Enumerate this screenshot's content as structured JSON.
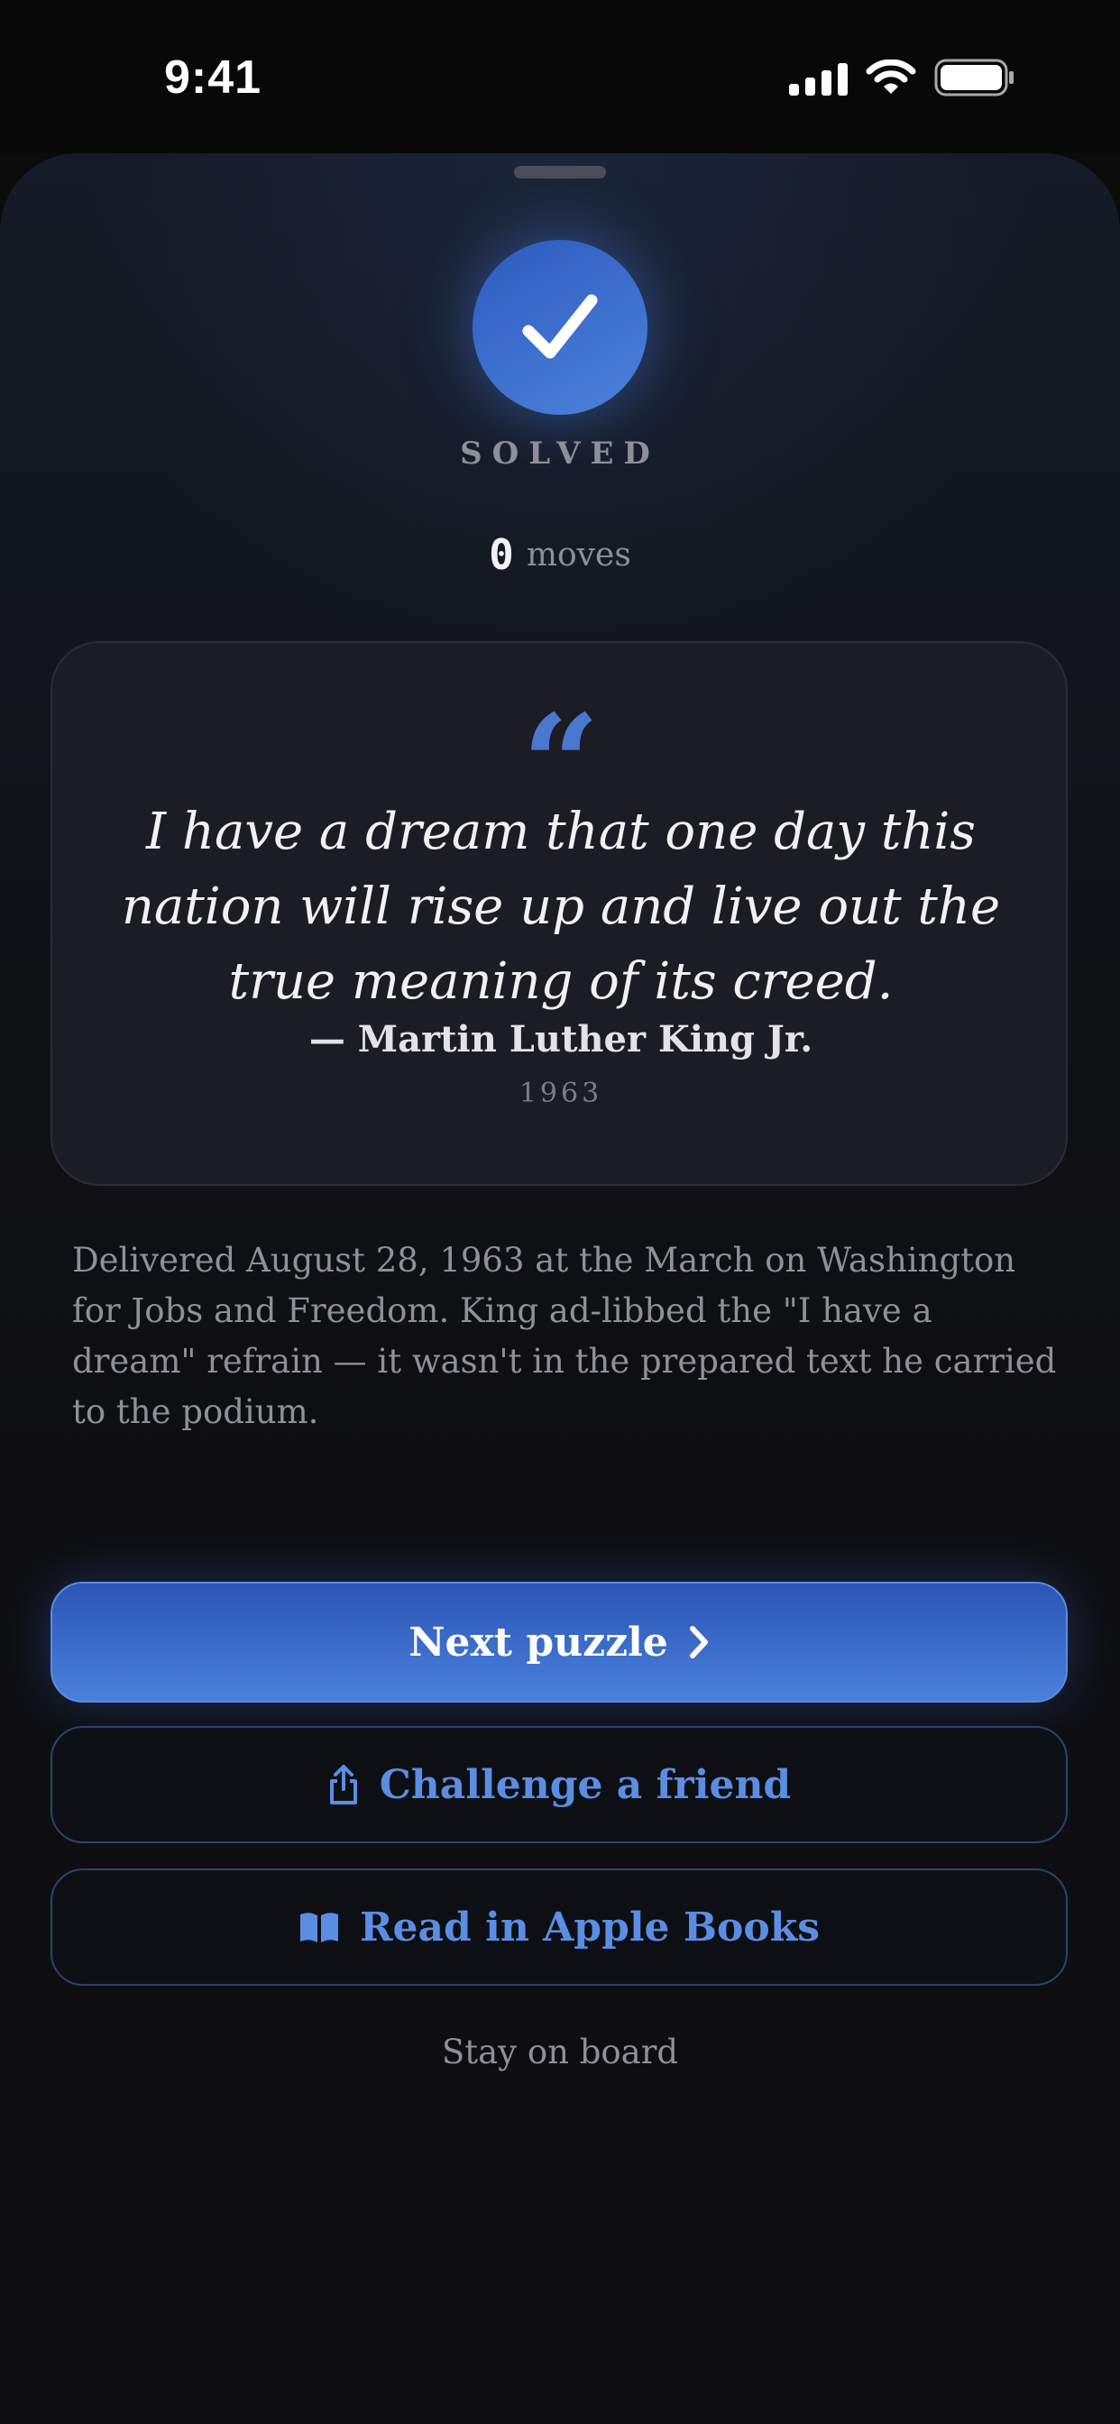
{
  "status_bar": {
    "time": "9:41",
    "icons": [
      "signal-icon",
      "wifi-icon",
      "battery-icon"
    ]
  },
  "result": {
    "status": "SOLVED",
    "moves_count": "0",
    "moves_label": "moves",
    "icon": "checkmark-icon"
  },
  "quote": {
    "mark": "“",
    "text": "I have a dream that one day this nation will rise up and live out the true meaning of its creed.",
    "author": "— Martin Luther King Jr.",
    "year": "1963"
  },
  "context": "Delivered August 28, 1963 at the March on Washington for Jobs and Freedom. King ad-libbed the \"I have a dream\" refrain — it wasn't in the prepared text he carried to the podium.",
  "actions": {
    "next_label": "Next puzzle",
    "challenge_label": "Challenge a friend",
    "books_label": "Read in Apple Books",
    "stay_label": "Stay on board"
  },
  "colors": {
    "accent": "#4a80db",
    "background": "#0e0e10",
    "card": "#1c1c24"
  }
}
